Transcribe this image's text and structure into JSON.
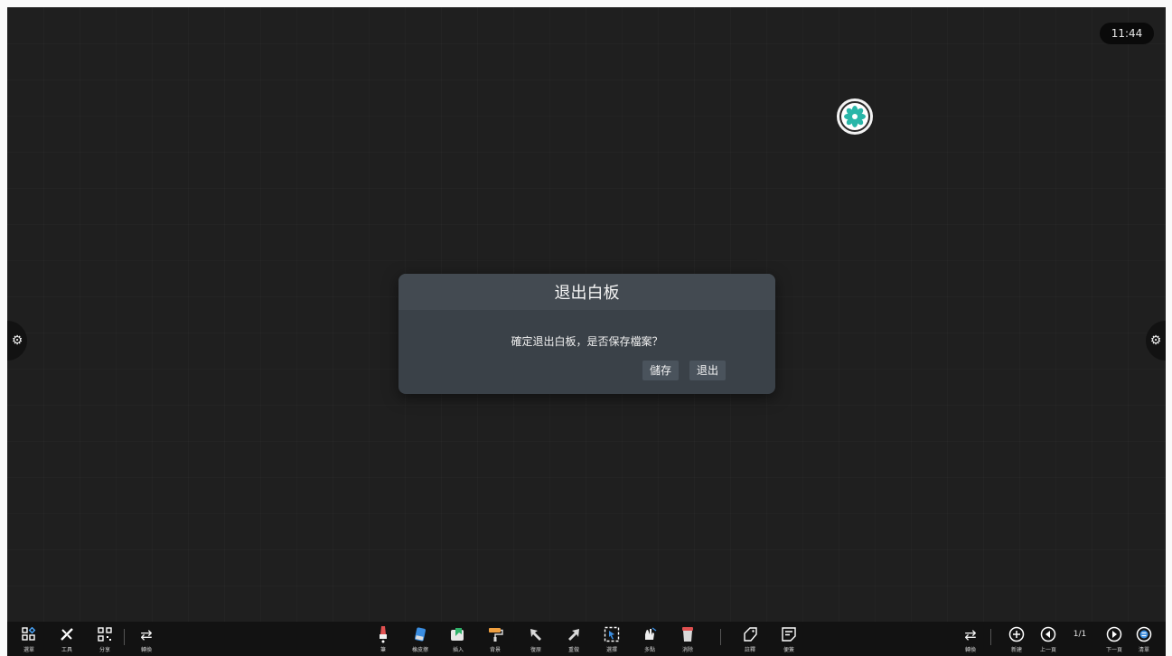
{
  "clock": {
    "time": "11:44"
  },
  "dialog": {
    "title": "退出白板",
    "message": "確定退出白板，是否保存檔案？",
    "save_label": "儲存",
    "exit_label": "退出"
  },
  "toolbar": {
    "left": [
      {
        "label": "選單",
        "icon": "menu-grid-icon"
      },
      {
        "label": "工具",
        "icon": "tools-icon"
      },
      {
        "label": "分享",
        "icon": "qr-share-icon"
      },
      {
        "label": "轉換",
        "icon": "switch-icon"
      }
    ],
    "center": [
      {
        "label": "筆",
        "icon": "pen-icon"
      },
      {
        "label": "橡皮擦",
        "icon": "eraser-icon"
      },
      {
        "label": "插入",
        "icon": "insert-icon"
      },
      {
        "label": "背景",
        "icon": "background-roller-icon"
      },
      {
        "label": "復原",
        "icon": "undo-icon"
      },
      {
        "label": "重做",
        "icon": "redo-icon"
      },
      {
        "label": "選擇",
        "icon": "select-icon"
      },
      {
        "label": "多點",
        "icon": "multi-touch-icon"
      },
      {
        "label": "消除",
        "icon": "clear-icon"
      },
      {
        "label": "註釋",
        "icon": "annotate-icon"
      },
      {
        "label": "便簽",
        "icon": "sticky-note-icon"
      }
    ],
    "right": [
      {
        "label": "轉換",
        "icon": "switch-icon"
      },
      {
        "label": "新建",
        "icon": "add-page-icon"
      },
      {
        "label": "上一頁",
        "icon": "prev-page-icon"
      },
      {
        "label": "下一頁",
        "icon": "next-page-icon"
      },
      {
        "label": "清單",
        "icon": "page-list-icon"
      }
    ],
    "page_indicator": "1/1"
  },
  "colors": {
    "canvas": "#1f1f1f",
    "toolbar": "#121212",
    "dialog": "#3a4148",
    "logo_accent": "#29b6a8"
  }
}
